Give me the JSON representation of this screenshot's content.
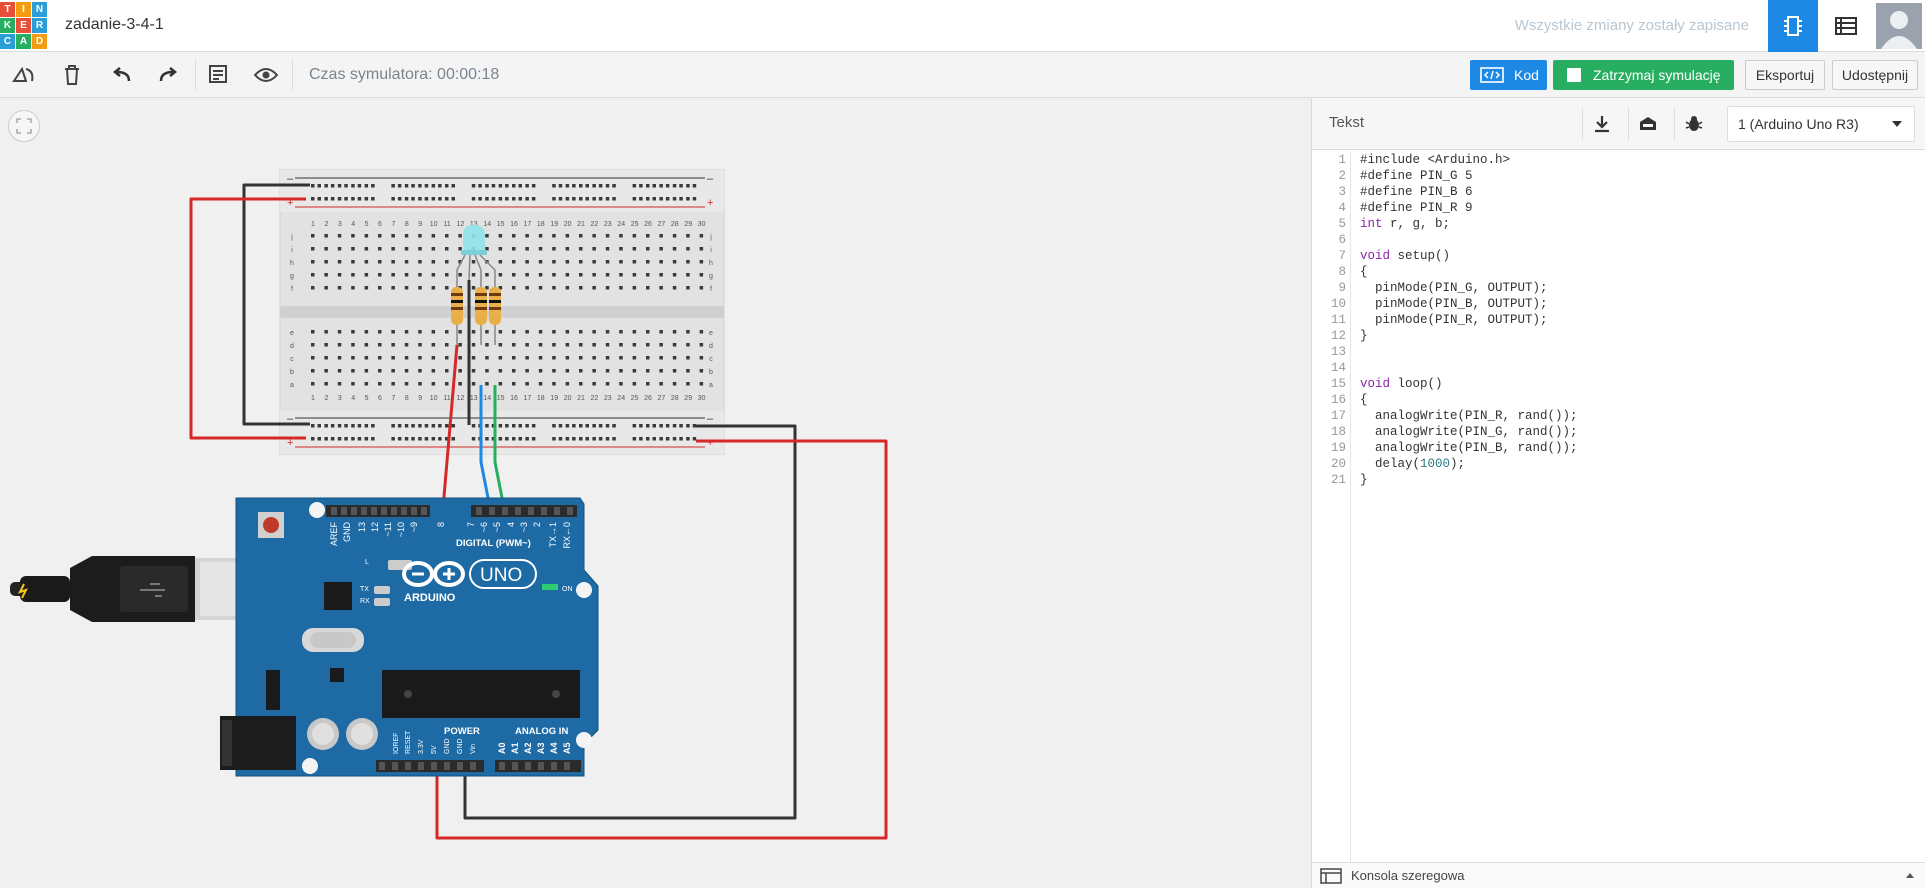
{
  "app": {
    "logo_letters": [
      "T",
      "I",
      "N",
      "K",
      "E",
      "R",
      "C",
      "A",
      "D"
    ],
    "logo_colors": [
      "#e94f37",
      "#f39c12",
      "#2b9ed8",
      "#27ae60",
      "#e94f37",
      "#2b9ed8",
      "#2b9ed8",
      "#27ae60",
      "#f39c12"
    ],
    "project_name": "zadanie-3-4-1",
    "save_status": "Wszystkie zmiany zostały zapisane"
  },
  "toolbar": {
    "sim_time": "Czas symulatora: 00:00:18",
    "code_label": "Kod",
    "stop_label": "Zatrzymaj symulację",
    "export_label": "Eksportuj",
    "share_label": "Udostępnij",
    "accent_blue": "#1e88e5",
    "accent_green": "#27ae60"
  },
  "code_panel": {
    "mode_label": "Tekst",
    "board_select": "1 (Arduino Uno R3)",
    "console_label": "Konsola szeregowa",
    "lines": [
      "#include <Arduino.h>",
      "#define PIN_G 5",
      "#define PIN_B 6",
      "#define PIN_R 9",
      "int r, g, b;",
      "",
      "void setup()",
      "{",
      "  pinMode(PIN_G, OUTPUT);",
      "  pinMode(PIN_B, OUTPUT);",
      "  pinMode(PIN_R, OUTPUT);",
      "}",
      "",
      "",
      "void loop()",
      "{",
      "  analogWrite(PIN_R, rand());",
      "  analogWrite(PIN_G, rand());",
      "  analogWrite(PIN_B, rand());",
      "  delay(1000);",
      "}"
    ]
  },
  "board": {
    "logo_text": "ARDUINO",
    "model": "UNO",
    "digital_label": "DIGITAL (PWM~)",
    "power_label": "POWER",
    "analog_label": "ANALOG IN",
    "on_label": "ON",
    "l_label": "L",
    "tx_label": "TX",
    "rx_label": "RX",
    "top_pins": [
      "AREF",
      "GND",
      "13",
      "12",
      "~11",
      "~10",
      "~9",
      "8",
      "7",
      "~6",
      "~5",
      "4",
      "~3",
      "2",
      "TX→1",
      "RX←0"
    ],
    "power_pins": [
      "IOREF",
      "RESET",
      "3.3V",
      "5V",
      "GND",
      "GND",
      "Vin"
    ],
    "analog_pins": [
      "A0",
      "A1",
      "A2",
      "A3",
      "A4",
      "A5"
    ]
  },
  "breadboard": {
    "columns": [
      "1",
      "2",
      "3",
      "4",
      "5",
      "6",
      "7",
      "8",
      "9",
      "10",
      "11",
      "12",
      "13",
      "14",
      "15",
      "16",
      "17",
      "18",
      "19",
      "20",
      "21",
      "22",
      "23",
      "24",
      "25",
      "26",
      "27",
      "28",
      "29",
      "30"
    ],
    "rows_top": [
      "j",
      "i",
      "h",
      "g",
      "f"
    ],
    "rows_bottom": [
      "e",
      "d",
      "c",
      "b",
      "a"
    ]
  }
}
